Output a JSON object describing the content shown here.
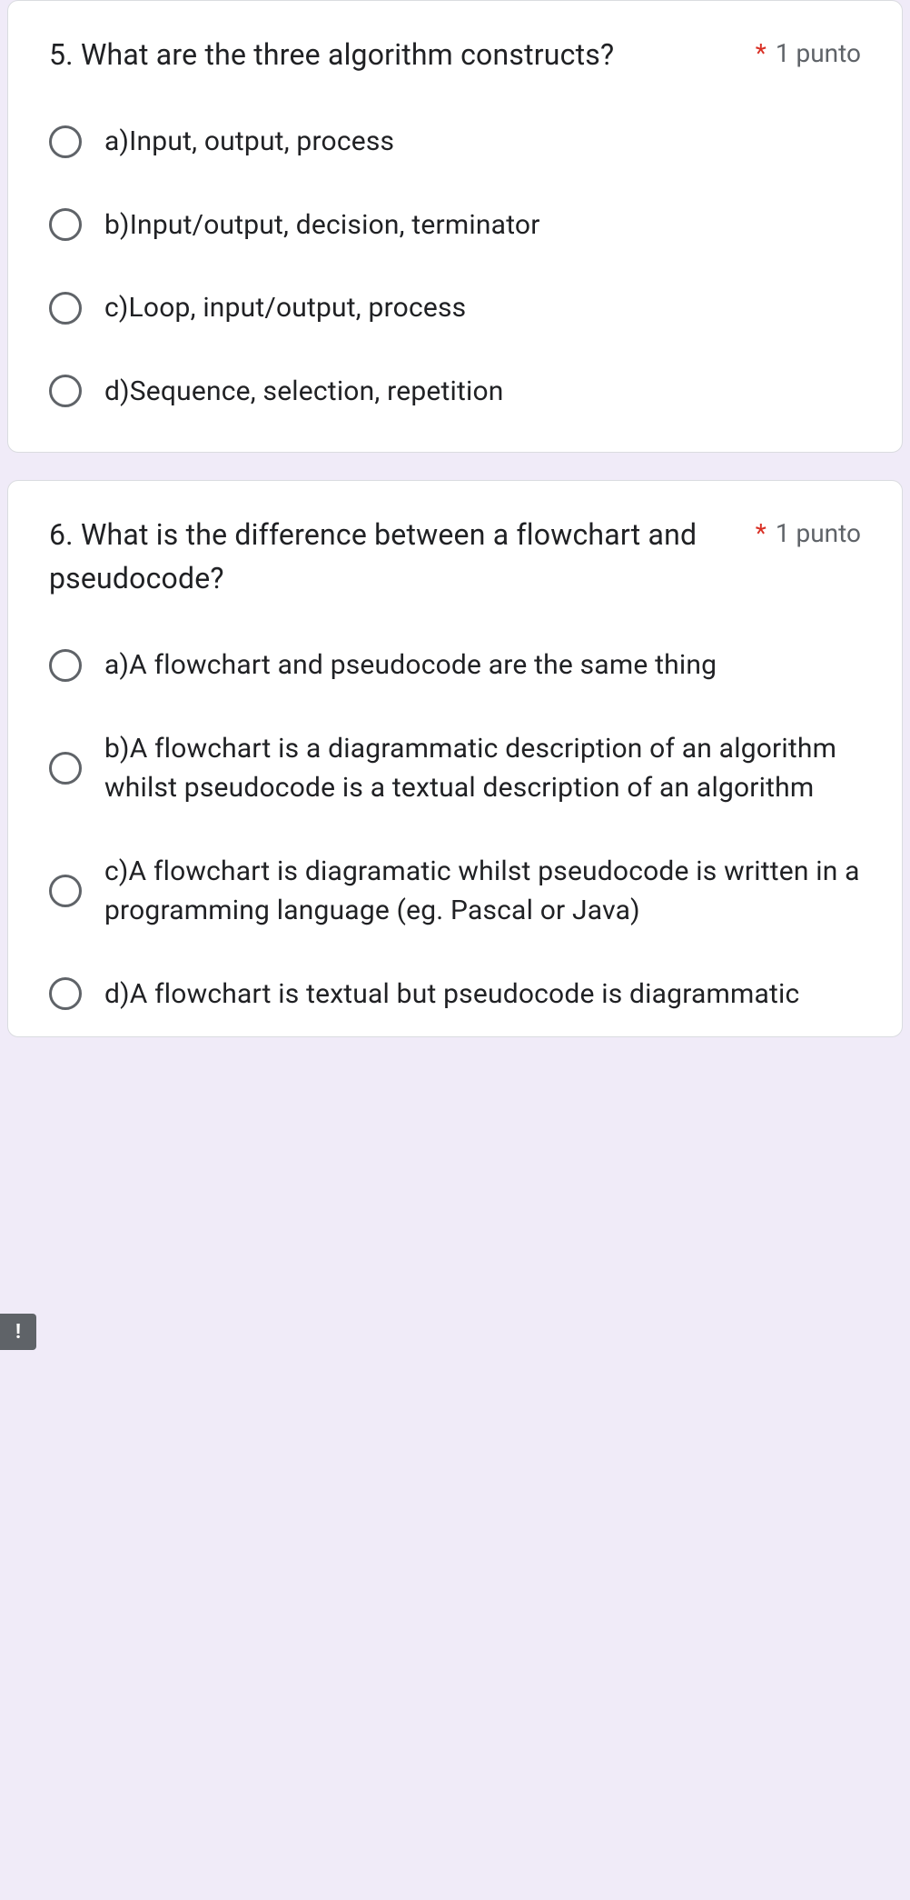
{
  "questions": [
    {
      "text": "5. What are the three algorithm constructs?",
      "required": "*",
      "points": "1 punto",
      "options": [
        "a)Input, output, process",
        "b)Input/output, decision, terminator",
        "c)Loop, input/output, process",
        "d)Sequence, selection, repetition"
      ]
    },
    {
      "text": "6. What is the difference between a flowchart and pseudocode?",
      "required": "*",
      "points": "1 punto",
      "options": [
        "a)A flowchart and pseudocode are the same thing",
        "b)A flowchart is a diagrammatic description of an algorithm whilst pseudocode is a textual description of an algorithm",
        "c)A flowchart is diagramatic whilst pseudocode is written in a programming language (eg. Pascal or Java)",
        "d)A flowchart is textual but pseudocode is diagrammatic"
      ]
    }
  ],
  "error_indicator": "!"
}
